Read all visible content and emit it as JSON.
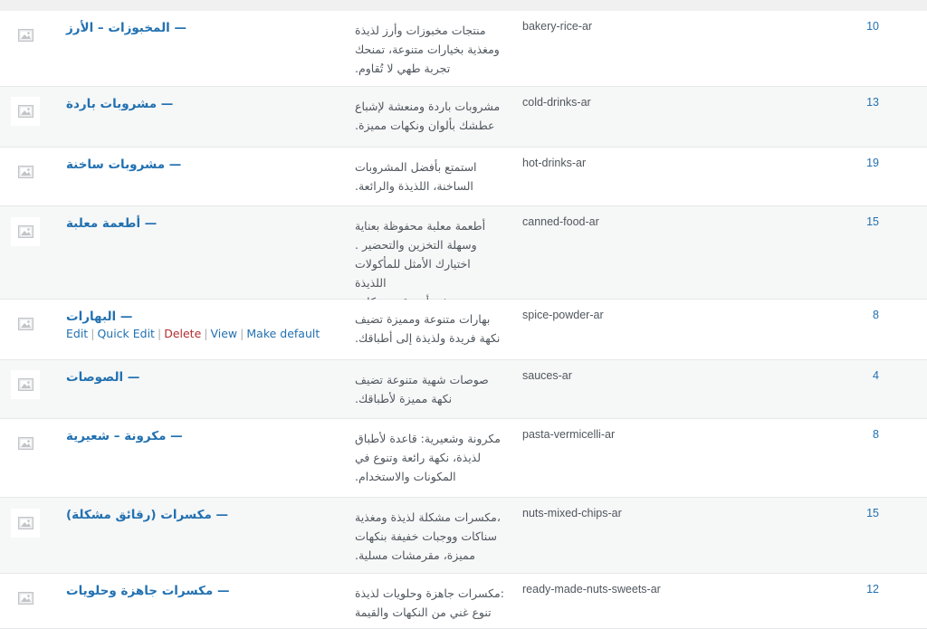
{
  "row_actions": {
    "edit": "Edit",
    "quick_edit": "Quick Edit",
    "delete": "Delete",
    "view": "View",
    "make_default": "Make default",
    "separator": "|"
  },
  "categories": [
    {
      "name": "— المخبوزات – الأرز",
      "description": [
        "منتجات مخبوزات وأرز لذيذة",
        "ومغذية بخيارات متنوعة، تمنحك",
        ".تجربة طهي لا تُقاوم"
      ],
      "slug": "bakery-rice-ar",
      "count": "10"
    },
    {
      "name": "— مشروبات باردة",
      "description": [
        "مشروبات باردة ومنعشة لإشباع",
        ".عطشك بألوان ونكهات مميزة"
      ],
      "slug": "cold-drinks-ar",
      "count": "13"
    },
    {
      "name": "— مشروبات ساخنة",
      "description": [
        "استمتع بأفضل المشروبات",
        ".الساخنة، اللذيذة والرائعة"
      ],
      "slug": "hot-drinks-ar",
      "count": "19"
    },
    {
      "name": "— أطعمة معلبة",
      "description": [
        "أطعمة معلبة محفوظة بعناية",
        ". وسهلة التخزين والتحضير",
        "اختيارك الأمثل للمأكولات اللذيذة",
        ".في أي وقت ومكان"
      ],
      "slug": "canned-food-ar",
      "count": "15"
    },
    {
      "name": "— البهارات",
      "description": [
        "بهارات متنوعة ومميزة تضيف",
        ".نكهة فريدة ولذيذة إلى أطباقك"
      ],
      "slug": "spice-powder-ar",
      "count": "8",
      "show_actions": true
    },
    {
      "name": "— الصوصات",
      "description": [
        "صوصات شهية متنوعة تضيف",
        ".نكهة مميزة لأطباقك"
      ],
      "slug": "sauces-ar",
      "count": "4"
    },
    {
      "name": "— مكرونة – شعيرية",
      "description": [
        "مكرونة وشعيرية: قاعدة لأطباق",
        "لذيذة، نكهة رائعة وتنوع في",
        ".المكونات والاستخدام"
      ],
      "slug": "pasta-vermicelli-ar",
      "count": "8"
    },
    {
      "name": "— مكسرات (رقائق مشكلة)",
      "description": [
        "مكسرات مشكلة لذيذة ومغذية،",
        "سناكات ووجبات خفيفة بنكهات",
        ".مميزة، مقرمشات مسلية"
      ],
      "slug": "nuts-mixed-chips-ar",
      "count": "15"
    },
    {
      "name": "— مكسرات جاهزة وحلويات",
      "description": [
        "مكسرات جاهزة وحلويات لذيذة:",
        "تنوع غني من النكهات والقيمة"
      ],
      "slug": "ready-made-nuts-sweets-ar",
      "count": "12"
    }
  ],
  "colors": {
    "link": "#2271b1",
    "delete": "#b32d2e",
    "row_odd": "#ffffff",
    "row_even": "#f6f7f7"
  },
  "icons": {
    "thumbnail": "image-placeholder-icon"
  }
}
